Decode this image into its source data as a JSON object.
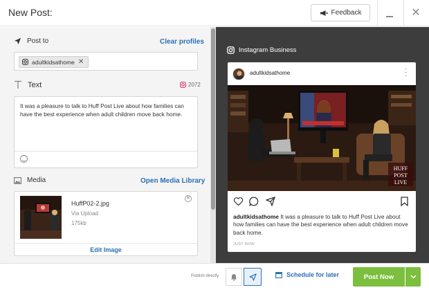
{
  "header": {
    "title": "New Post:",
    "feedback_label": "Feedback",
    "icons": [
      "megaphone-icon",
      "minimize-icon",
      "close-icon"
    ]
  },
  "post_to": {
    "label": "Post to",
    "clear_label": "Clear profiles",
    "profiles": [
      {
        "name": "adultkidsathome",
        "icon": "instagram-icon"
      }
    ]
  },
  "text_section": {
    "label": "Text",
    "char_count": "2072",
    "content": "It was a pleasure to talk to Huff Post Live about how families can have the best experience when adult children move back home."
  },
  "media": {
    "label": "Media",
    "open_library_label": "Open Media Library",
    "file_name": "HuffP02-2.jpg",
    "source": "Via Upload",
    "size": "175kb",
    "edit_label": "Edit Image"
  },
  "preview": {
    "network_label": "Instagram Business",
    "username": "adultkidsathome",
    "caption": "It was a pleasure to talk to Huff Post Live about how families can have the best experience when adult children move back home.",
    "timestamp": "JUST NOW",
    "image_brand_text": [
      "HUFF",
      "POST",
      "LIVE"
    ]
  },
  "footer": {
    "publish_label": "Publish directly",
    "schedule_label": "Schedule for later",
    "post_now_label": "Post Now"
  },
  "colors": {
    "accent_blue": "#2a6fb5",
    "post_green": "#7cbf3f",
    "preview_bg": "#3d3d3d",
    "instagram_pink": "#d6336c"
  }
}
